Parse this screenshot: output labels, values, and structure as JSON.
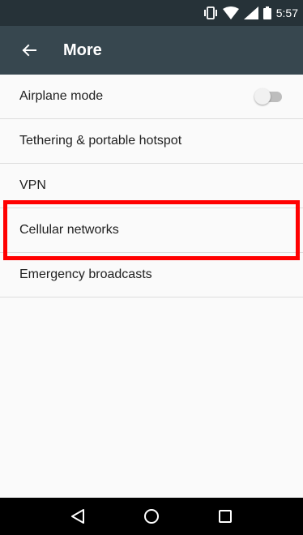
{
  "status_bar": {
    "time": "5:57",
    "icons": [
      "vibrate-icon",
      "wifi-icon",
      "signal-icon",
      "battery-icon"
    ]
  },
  "toolbar": {
    "title": "More",
    "back_icon": "arrow-back-icon"
  },
  "settings": {
    "items": [
      {
        "label": "Airplane mode",
        "toggle": {
          "state": "off"
        }
      },
      {
        "label": "Tethering & portable hotspot"
      },
      {
        "label": "VPN"
      },
      {
        "label": "Cellular networks",
        "highlighted": true
      },
      {
        "label": "Emergency broadcasts"
      }
    ]
  },
  "nav_bar": {
    "icons": [
      "back-triangle-icon",
      "home-circle-icon",
      "recents-square-icon"
    ]
  },
  "colors": {
    "status_bar": "#263238",
    "toolbar": "#37474F",
    "background": "#FAFAFA",
    "highlight": "#FF0000",
    "nav_bar": "#000000"
  }
}
